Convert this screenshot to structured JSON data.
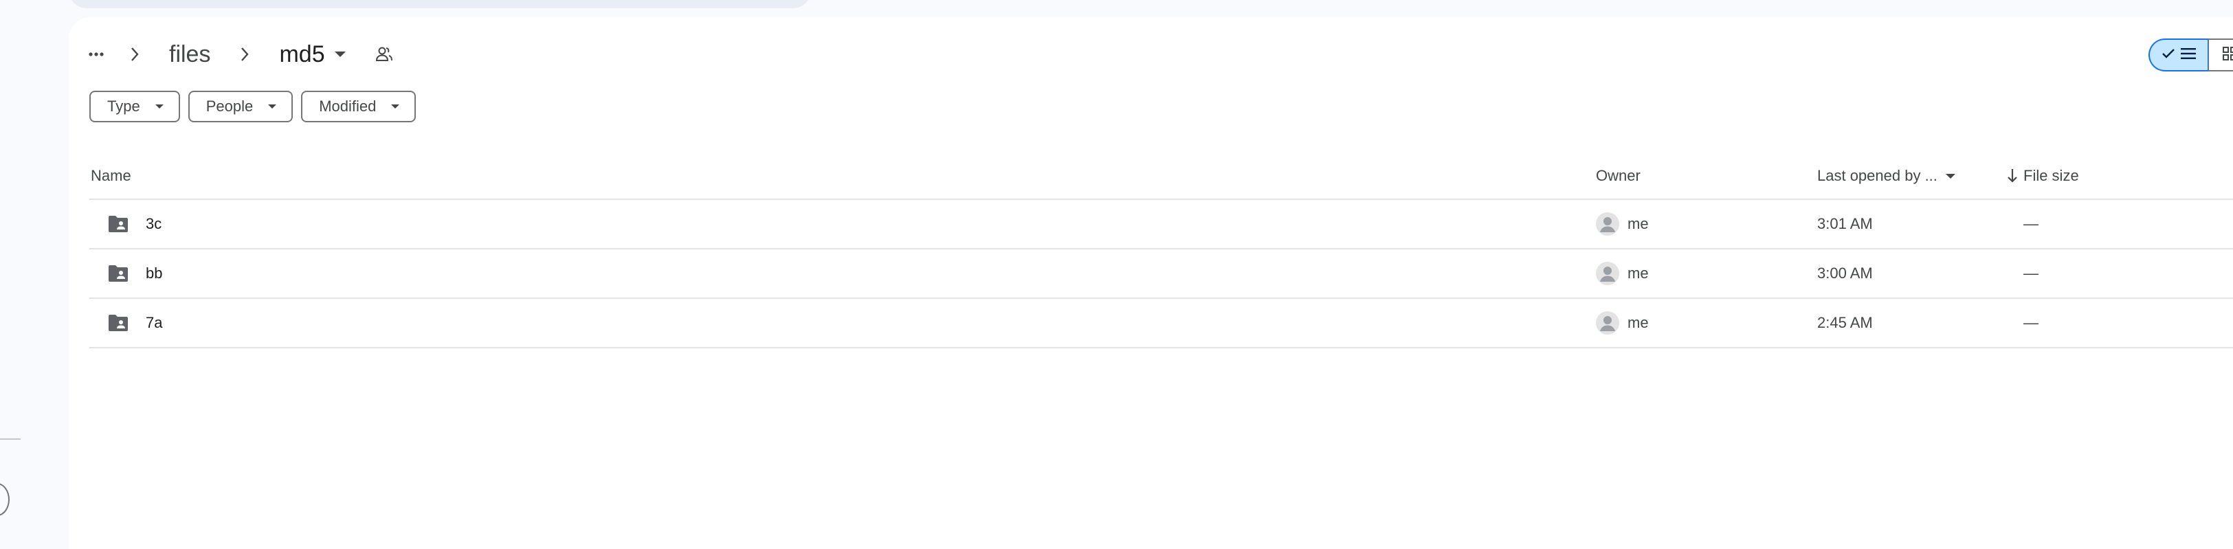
{
  "breadcrumb": {
    "more_icon": "more-horiz-icon",
    "items": [
      {
        "label": "files"
      },
      {
        "label": "md5"
      }
    ],
    "share_icon": "shared-people-icon"
  },
  "view_toggle": {
    "list_icon": "list-view-icon",
    "check_icon": "check-icon",
    "grid_icon": "grid-view-icon",
    "selected": "list"
  },
  "filters": [
    {
      "label": "Type"
    },
    {
      "label": "People"
    },
    {
      "label": "Modified"
    }
  ],
  "table": {
    "columns": {
      "name": "Name",
      "owner": "Owner",
      "last_opened": "Last opened by ...",
      "file_size": "File size"
    },
    "sort_icon": "arrow-down-icon",
    "rows": [
      {
        "name": "3c",
        "owner": "me",
        "last_opened": "3:01 AM",
        "size": "—",
        "icon": "shared-folder-icon"
      },
      {
        "name": "bb",
        "owner": "me",
        "last_opened": "3:00 AM",
        "size": "—",
        "icon": "shared-folder-icon"
      },
      {
        "name": "7a",
        "owner": "me",
        "last_opened": "2:45 AM",
        "size": "—",
        "icon": "shared-folder-icon"
      }
    ]
  },
  "colors": {
    "background": "#f8fafd",
    "panel": "#ffffff",
    "selected_toggle": "#c2e7ff",
    "text_secondary": "#444746",
    "divider": "#e3e3e3"
  }
}
